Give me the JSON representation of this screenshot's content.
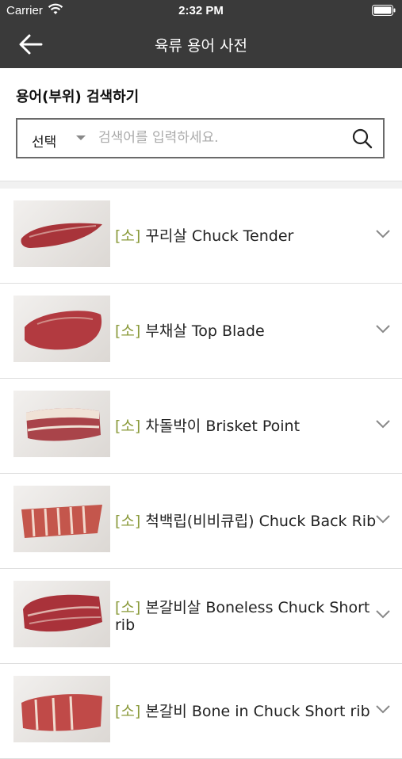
{
  "status_bar": {
    "carrier": "Carrier",
    "time": "2:32 PM"
  },
  "header": {
    "title": "육류 용어 사전"
  },
  "search": {
    "heading": "용어(부위) 검색하기",
    "select_label": "선택",
    "placeholder": "검색어를 입력하세요."
  },
  "items": [
    {
      "category": "[소]",
      "name": "꾸리살 Chuck Tender",
      "meat_color": "#a8343a",
      "fat_color": "#e8c9c0"
    },
    {
      "category": "[소]",
      "name": "부채살 Top Blade",
      "meat_color": "#b23a40",
      "fat_color": "#e4c3b8"
    },
    {
      "category": "[소]",
      "name": "차돌박이 Brisket Point",
      "meat_color": "#a9444a",
      "fat_color": "#f0e2d6"
    },
    {
      "category": "[소]",
      "name": "척백립(비비큐립) Chuck Back Rib",
      "meat_color": "#c4564c",
      "fat_color": "#f2d8cc"
    },
    {
      "category": "[소]",
      "name": "본갈비살 Boneless Chuck Short rib",
      "meat_color": "#a9323a",
      "fat_color": "#ecd2c8"
    },
    {
      "category": "[소]",
      "name": "본갈비 Bone in Chuck Short rib",
      "meat_color": "#c04a48",
      "fat_color": "#f0dcd0"
    }
  ]
}
